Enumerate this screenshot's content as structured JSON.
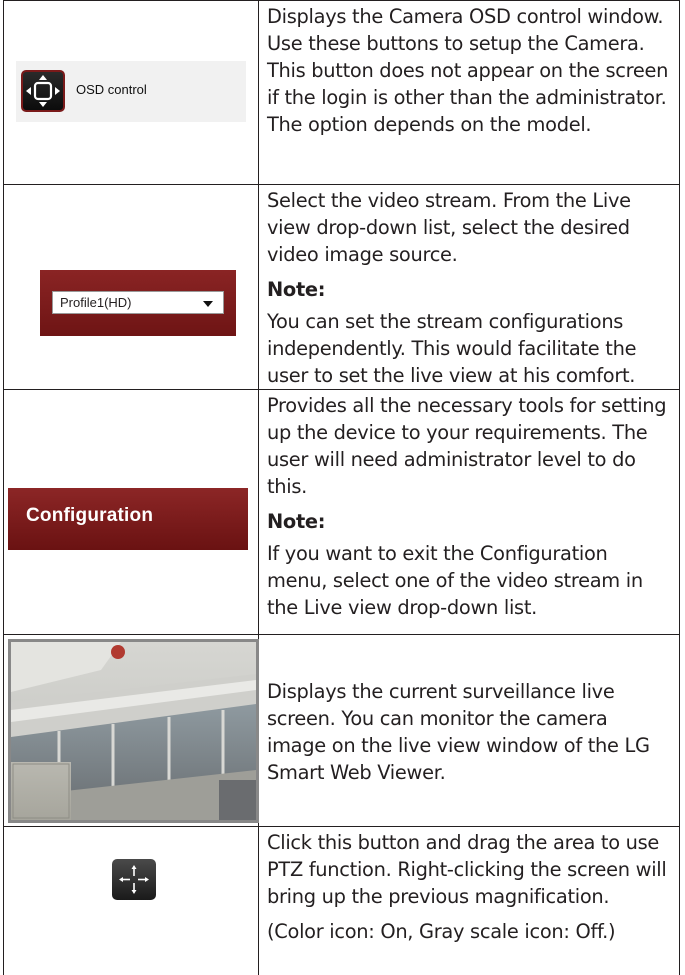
{
  "rows": [
    {
      "icon_label": "OSD control",
      "description": "Displays the Camera OSD control window. Use these buttons to setup the Camera. This button does not appear on the screen if the login is other than the administrator. The option depends on the model."
    },
    {
      "dropdown_value": "Profile1(HD)",
      "description": "Select the video stream. From the Live view drop-down list, select the desired video image source.",
      "note_label": "Note:",
      "note_text": "You can set the stream configurations independently. This would facilitate the user to set the live view at his comfort."
    },
    {
      "button_label": "Configuration",
      "description": "Provides all the necessary tools for setting up the device to your requirements. The user will need administrator level to do this.",
      "note_label": "Note:",
      "note_text": "If you want to exit the Configuration menu, select one of the video stream in the Live view drop-down list."
    },
    {
      "description": "Displays the current surveillance live screen. You can monitor the camera image on the live view window of the LG Smart Web Viewer."
    },
    {
      "description": "Click this button and drag the area to use PTZ function. Right-clicking the screen will bring up the previous magnification.",
      "extra": "(Color icon: On, Gray scale icon: Off.)"
    }
  ]
}
